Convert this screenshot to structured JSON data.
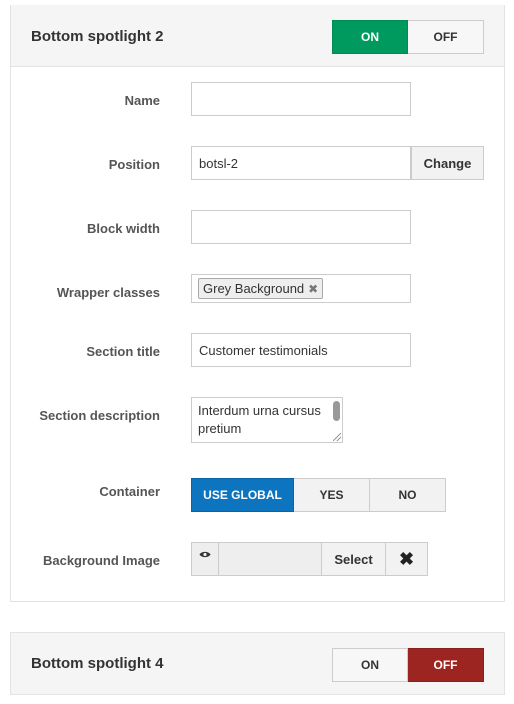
{
  "panel1": {
    "title": "Bottom spotlight 2",
    "toggle_on": "ON",
    "toggle_off": "OFF",
    "state": "ON",
    "fields": {
      "name": {
        "label": "Name",
        "value": ""
      },
      "position": {
        "label": "Position",
        "value": "botsl-2",
        "button": "Change"
      },
      "block_width": {
        "label": "Block width",
        "value": ""
      },
      "wrapper_classes": {
        "label": "Wrapper classes",
        "tag": "Grey Background",
        "tag_remove": "✖"
      },
      "section_title": {
        "label": "Section title",
        "value": "Customer testimonials"
      },
      "section_description": {
        "label": "Section description",
        "value": "Interdum urna cursus pretium"
      },
      "container": {
        "label": "Container",
        "options": [
          "USE GLOBAL",
          "YES",
          "NO"
        ],
        "selected": "USE GLOBAL"
      },
      "background_image": {
        "label": "Background Image",
        "select": "Select",
        "clear": "✖"
      }
    }
  },
  "panel2": {
    "title": "Bottom spotlight 4",
    "toggle_on": "ON",
    "toggle_off": "OFF",
    "state": "OFF"
  },
  "colors": {
    "on_active": "#00995e",
    "off_active": "#9d2521",
    "segment_active": "#0d74bf"
  },
  "icons": {
    "preview": "eye-icon",
    "clear": "close-icon",
    "tag_remove": "close-icon"
  }
}
